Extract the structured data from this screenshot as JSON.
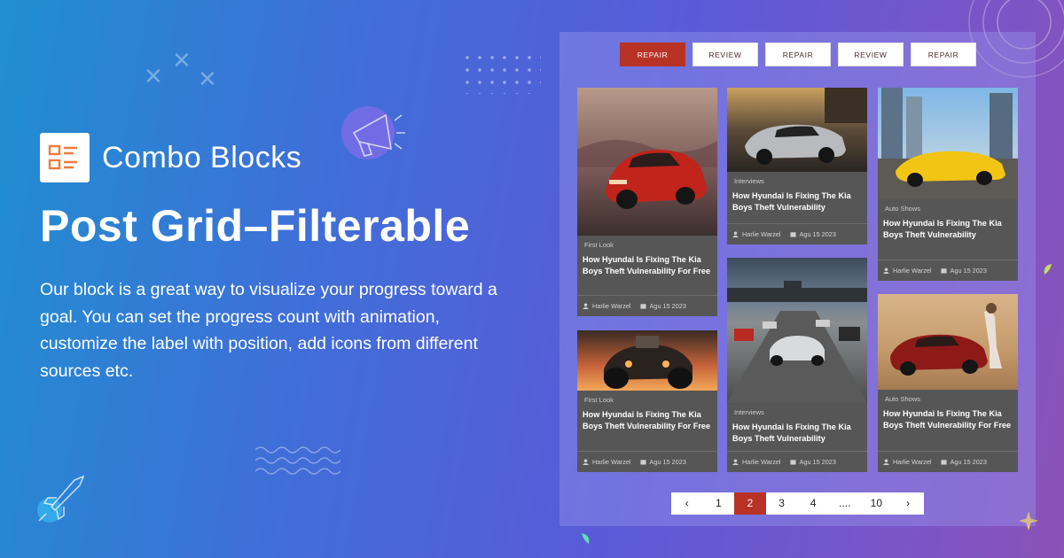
{
  "brand": {
    "name": "Combo Blocks"
  },
  "hero": {
    "title": "Post Grid–Filterable",
    "description": "Our block is a great way to visualize your progress toward a goal. You can set the progress count with animation, customize the label with position, add icons from different sources etc."
  },
  "filters": [
    {
      "label": "REPAIR",
      "active": true
    },
    {
      "label": "REVIEW",
      "active": false
    },
    {
      "label": "REPAIR",
      "active": false
    },
    {
      "label": "REVIEW",
      "active": false
    },
    {
      "label": "REPAIR",
      "active": false
    }
  ],
  "cards": [
    {
      "category": "First Look",
      "title": "How Hyundai Is Fixing The Kia Boys Theft Vulnerability For Free",
      "author": "Harlie Warzel",
      "date": "Agu 15 2023",
      "image": "red-bmw-car"
    },
    {
      "category": "Interviews",
      "title": "How Hyundai Is Fixing The Kia Boys Theft Vulnerability",
      "author": "Harlie Warzel",
      "date": "Agu 15 2023",
      "image": "silver-roadster-car"
    },
    {
      "category": "Auto Shows",
      "title": "How Hyundai Is Fixing The Kia Boys Theft Vulnerability",
      "author": "Harlie Warzel",
      "date": "Agu 15 2023",
      "image": "yellow-convertible-car"
    },
    {
      "category": "First Look",
      "title": "How Hyundai Is Fixing The Kia Boys Theft Vulnerability For Free",
      "author": "Harlie Warzel",
      "date": "Agu 15 2023",
      "image": "hot-rod-car"
    },
    {
      "category": "Interviews",
      "title": "How Hyundai Is Fixing The Kia Boys Theft Vulnerability",
      "author": "Harlie Warzel",
      "date": "Agu 15 2023",
      "image": "race-track-cars"
    },
    {
      "category": "Auto Shows",
      "title": "How Hyundai Is Fixing The Kia Boys Theft Vulnerability For Free",
      "author": "Harlie Warzel",
      "date": "Agu 15 2023",
      "image": "red-corvette-desert"
    }
  ],
  "pagination": {
    "prev": "‹",
    "pages": [
      "1",
      "2",
      "3",
      "4",
      "....",
      "10"
    ],
    "current": "2",
    "next": "›"
  },
  "colors": {
    "accent": "#b83226",
    "card_bg": "#565656",
    "brand_icon": "#f07b3a"
  }
}
